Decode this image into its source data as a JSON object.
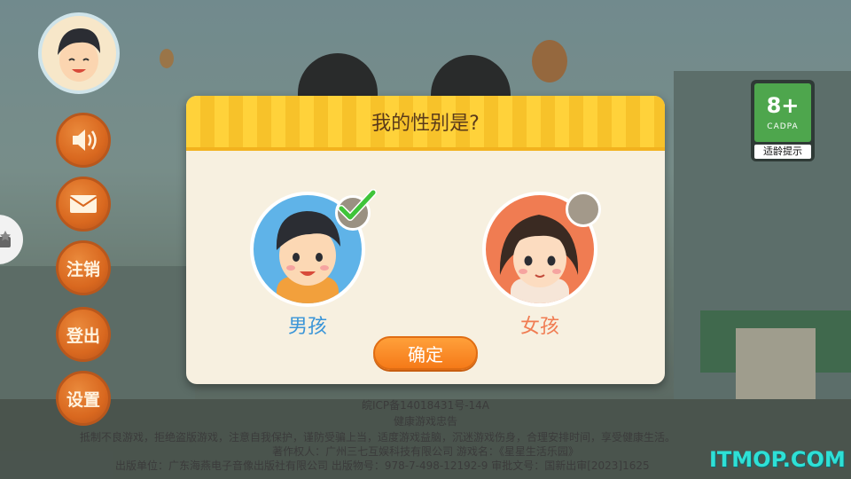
{
  "dialog": {
    "title": "我的性别是?",
    "boy_label": "男孩",
    "girl_label": "女孩",
    "selected": "男孩",
    "confirm_label": "确定"
  },
  "sidebar": {
    "items": [
      {
        "icon": "speaker-icon"
      },
      {
        "icon": "mail-icon"
      },
      {
        "label": "注销"
      },
      {
        "label": "登出"
      },
      {
        "label": "设置"
      }
    ]
  },
  "age_rating": {
    "age": "8+",
    "org": "CADPA",
    "tip": "适龄提示"
  },
  "footer": {
    "icp": "皖ICP备14018431号-14A",
    "notice_title": "健康游戏忠告",
    "notice_text": "抵制不良游戏，拒绝盗版游戏，注意自我保护，谨防受骗上当，适度游戏益脑，沉迷游戏伤身，合理安排时间，享受健康生活。",
    "copyright": "著作权人：广州三七互娱科技有限公司   游戏名：《星星生活乐园》",
    "publisher": "出版单位：广东海燕电子音像出版社有限公司   出版物号：978-7-498-12192-9   审批文号：国新出审[2023]1625"
  },
  "watermark": "ITMOP.COM",
  "colors": {
    "accent_orange": "#f57a19",
    "header_yellow": "#ffd23a",
    "boy_blue": "#3a95d8",
    "girl_coral": "#f07c52",
    "check_green": "#3fc43a"
  }
}
